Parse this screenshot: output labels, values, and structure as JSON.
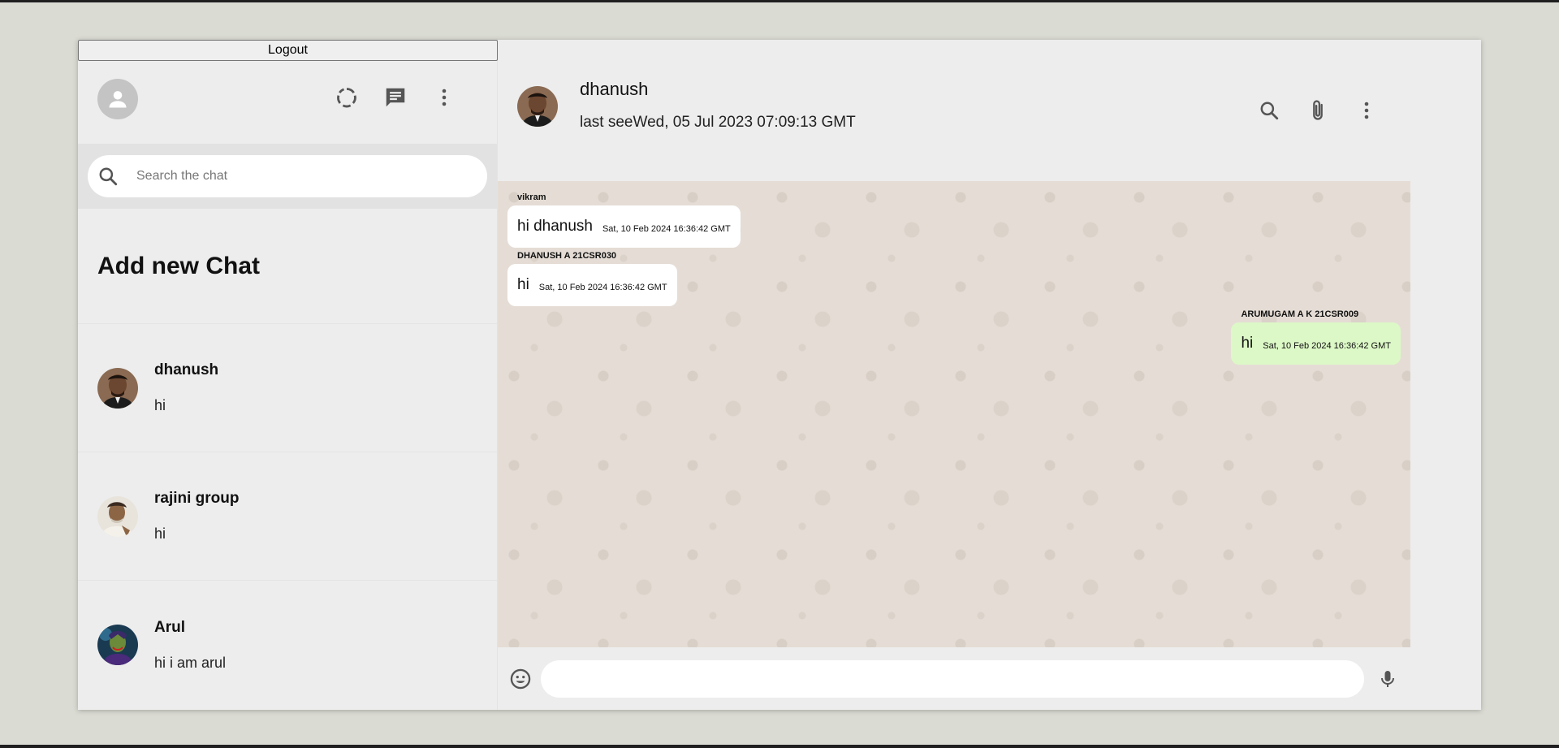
{
  "sidebar": {
    "logout_label": "Logout",
    "search_placeholder": "Search the chat",
    "add_chat_label": "Add new Chat",
    "chats": [
      {
        "name": "dhanush",
        "last_message": "hi",
        "avatar": "dhanush-avatar"
      },
      {
        "name": "rajini group",
        "last_message": "hi",
        "avatar": "rajini-avatar"
      },
      {
        "name": "Arul",
        "last_message": "hi i am arul",
        "avatar": "arul-avatar"
      }
    ]
  },
  "header": {
    "name": "dhanush",
    "status": "last seeWed, 05 Jul 2023 07:09:13 GMT"
  },
  "messages": [
    {
      "sender": "vikram",
      "text": "hi dhanush",
      "time": "Sat, 10 Feb 2024 16:36:42 GMT",
      "mine": false
    },
    {
      "sender": "DHANUSH A 21CSR030",
      "text": "hi",
      "time": "Sat, 10 Feb 2024 16:36:42 GMT",
      "mine": false
    },
    {
      "sender": "ARUMUGAM A K 21CSR009",
      "text": "hi",
      "time": "Sat, 10 Feb 2024 16:36:42 GMT",
      "mine": true
    }
  ],
  "footer": {
    "message_value": ""
  },
  "colors": {
    "sent_bubble": "#dcf8c6",
    "received_bubble": "#ffffff",
    "chat_background": "#e5ddd5"
  }
}
